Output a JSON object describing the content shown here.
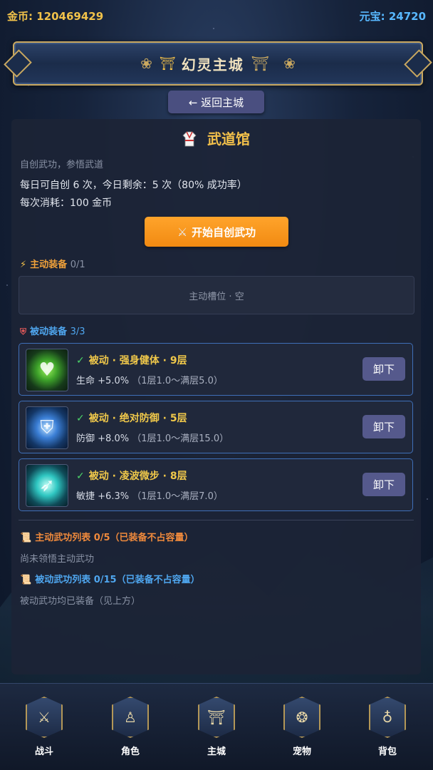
{
  "currency": {
    "gold": "金币: 120469429",
    "gem": "元宝: 24720"
  },
  "banner": {
    "title": "幻灵主城"
  },
  "back_button": "← 返回主城",
  "hall": {
    "title": "武道馆",
    "subtitle": "自创武功，参悟武道",
    "info_line1": "每日可自创 6 次，今日剩余：5 次（80% 成功率）",
    "info_line2": "每次消耗：100 金币",
    "create_button": "开始自创武功"
  },
  "active_equip": {
    "label": "主动装备",
    "count": "0/1",
    "empty_slot": "主动槽位 · 空"
  },
  "passive_equip": {
    "label": "被动装备",
    "count": "3/3",
    "skills": [
      {
        "name": "被动 · 强身健体 · 9层",
        "stat": "生命",
        "value": "+5.0%",
        "range": "（1层1.0～满层5.0）",
        "button": "卸下",
        "icon": "heart-icon"
      },
      {
        "name": "被动 · 绝对防御 · 5层",
        "stat": "防御",
        "value": "+8.0%",
        "range": "（1层1.0～满层15.0）",
        "button": "卸下",
        "icon": "shield-icon"
      },
      {
        "name": "被动 · 凌波微步 · 8层",
        "stat": "敏捷",
        "value": "+6.3%",
        "range": "（1层1.0～满层7.0）",
        "button": "卸下",
        "icon": "runner-icon"
      }
    ]
  },
  "lists": {
    "active_title": "主动武功列表 0/5（已装备不占容量）",
    "active_note": "尚未领悟主动武功",
    "passive_title": "被动武功列表 0/15（已装备不占容量）",
    "passive_note": "被动武功均已装备（见上方）"
  },
  "nav": [
    {
      "label": "战斗",
      "icon": "crossed-swords-icon"
    },
    {
      "label": "角色",
      "icon": "character-icon"
    },
    {
      "label": "主城",
      "icon": "pagoda-icon"
    },
    {
      "label": "宠物",
      "icon": "paw-icon"
    },
    {
      "label": "背包",
      "icon": "bag-icon"
    }
  ],
  "colors": {
    "gold_text": "#f1c24a",
    "gem_text": "#58b8ff",
    "accent_orange": "#f18a12",
    "passive_blue": "#4fa7f0",
    "card_border": "#3f6fb8"
  }
}
